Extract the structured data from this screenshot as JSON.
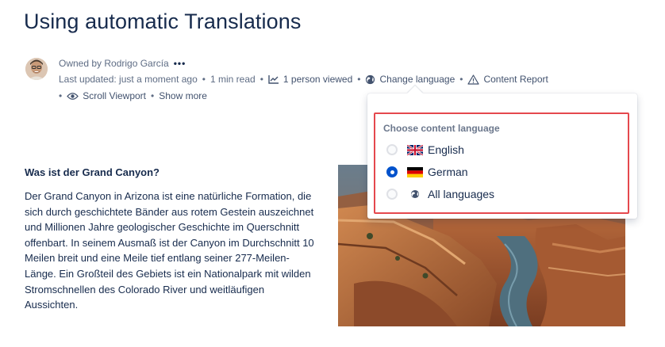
{
  "page": {
    "title": "Using automatic Translations"
  },
  "byline": {
    "owned_by": "Owned by Rodrigo García",
    "more": "•••",
    "last_updated": "Last updated: just a moment ago",
    "read_time": "1 min read",
    "viewed": "1 person viewed",
    "change_language": "Change language",
    "content_report": "Content Report",
    "scroll_viewport": "Scroll Viewport",
    "show_more": "Show more",
    "separator": "•"
  },
  "article": {
    "heading": "Was ist der Grand Canyon?",
    "body": "Der Grand Canyon in Arizona ist eine natürliche Formation, die sich durch geschichtete Bänder aus rotem Gestein auszeichnet und Millionen Jahre geologischer Geschichte im Querschnitt offenbart. In seinem Ausmaß ist der Canyon im Durchschnitt 10 Meilen breit und eine Meile tief entlang seiner 277-Meilen-Länge. Ein Großteil des Gebiets ist ein Nationalpark mit wilden Stromschnellen des Colorado River und weitläufigen Aussichten."
  },
  "language_popover": {
    "title": "Choose content language",
    "selected": "German",
    "options": [
      {
        "label": "English",
        "icon": "uk-flag-icon",
        "selected": false
      },
      {
        "label": "German",
        "icon": "german-flag-icon",
        "selected": true
      },
      {
        "label": "All languages",
        "icon": "globe-icon",
        "selected": false
      }
    ],
    "highlight_color": "#e5484d"
  },
  "colors": {
    "accent": "#0052cc",
    "text": "#172b4d",
    "subtle": "#5e6c84"
  }
}
